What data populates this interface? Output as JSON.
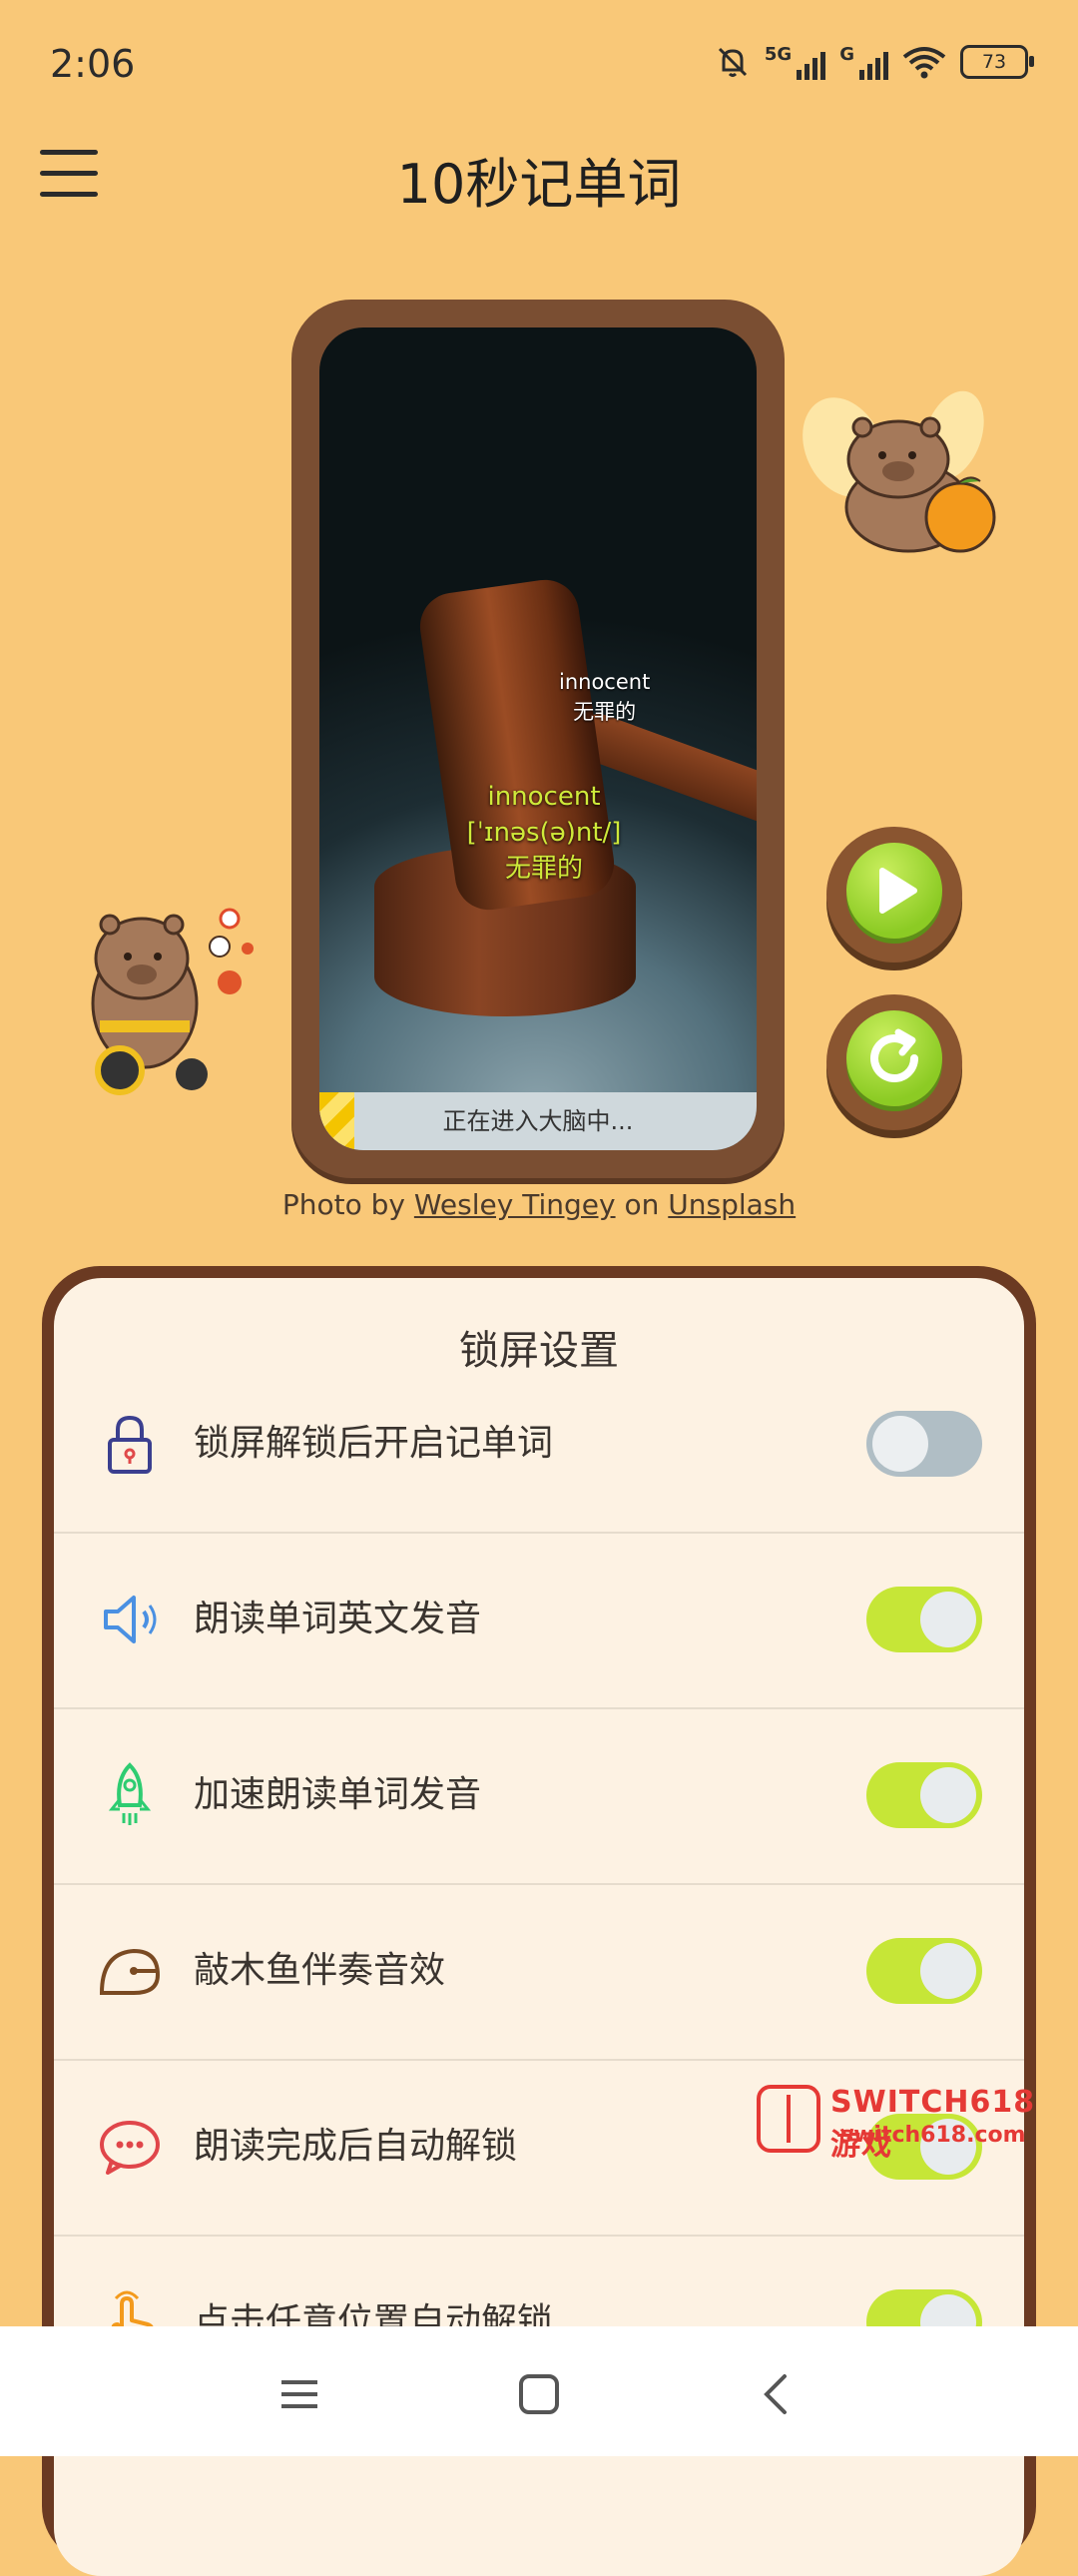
{
  "status_bar": {
    "time": "2:06",
    "network1": "5G",
    "network2": "G",
    "battery": "73"
  },
  "app_bar": {
    "title": "10秒记单词"
  },
  "preview": {
    "word_small": "innocent",
    "meaning_small": "无罪的",
    "word_big": "innocent",
    "phonetic": "[ˈɪnəs(ə)nt/]",
    "meaning_big": "无罪的",
    "progress_text": "正在进入大脑中...",
    "progress_fraction": 0.08
  },
  "credit": {
    "prefix": "Photo by",
    "author": "Wesley Tingey",
    "on": "on",
    "source": "Unsplash"
  },
  "settings": {
    "title": "锁屏设置",
    "items": [
      {
        "label": "锁屏解锁后开启记单词",
        "icon": "lock-icon",
        "enabled": false
      },
      {
        "label": "朗读单词英文发音",
        "icon": "speaker-icon",
        "enabled": true
      },
      {
        "label": "加速朗读单词发音",
        "icon": "rocket-icon",
        "enabled": true
      },
      {
        "label": "敲木鱼伴奏音效",
        "icon": "wooden-fish-icon",
        "enabled": true
      },
      {
        "label": "朗读完成后自动解锁",
        "icon": "chat-bubble-icon",
        "enabled": true
      },
      {
        "label": "点击任意位置自动解锁",
        "icon": "tap-hand-icon",
        "enabled": true
      }
    ]
  },
  "watermark": {
    "line1": "SWITCH618游戏",
    "line2": "switch618.com"
  },
  "colors": {
    "background": "#f9c878",
    "panel_border": "#6b3a22",
    "toggle_on": "#c6e637",
    "toggle_off": "#b0bec5"
  }
}
